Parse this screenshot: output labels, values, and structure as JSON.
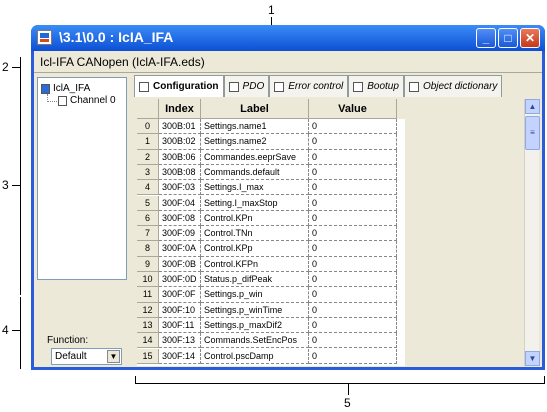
{
  "callouts": {
    "c1": "1",
    "c2": "2",
    "c3": "3",
    "c4": "4",
    "c5": "5"
  },
  "window": {
    "title": "\\3.1\\0.0 : IcIA_IFA",
    "device_header": "Icl-IFA CANopen (IclA-IFA.eds)"
  },
  "tree": {
    "root": "IclA_IFA",
    "child": "Channel 0"
  },
  "function_panel": {
    "label": "Function:",
    "selected": "Default"
  },
  "tabs": [
    "Configuration",
    "PDO",
    "Error control",
    "Bootup",
    "Object dictionary"
  ],
  "table": {
    "headers": {
      "index": "Index",
      "label": "Label",
      "value": "Value"
    },
    "rows": [
      {
        "num": "0",
        "index": "300B:01",
        "label": "Settings.name1",
        "value": "0"
      },
      {
        "num": "1",
        "index": "300B:02",
        "label": "Settings.name2",
        "value": "0"
      },
      {
        "num": "2",
        "index": "300B:06",
        "label": "Commandes.eeprSave",
        "value": "0"
      },
      {
        "num": "3",
        "index": "300B:08",
        "label": "Commands.default",
        "value": "0"
      },
      {
        "num": "4",
        "index": "300F:03",
        "label": "Settings.I_max",
        "value": "0"
      },
      {
        "num": "5",
        "index": "300F:04",
        "label": "Setting.I_maxStop",
        "value": "0"
      },
      {
        "num": "6",
        "index": "300F:08",
        "label": "Control.KPn",
        "value": "0"
      },
      {
        "num": "7",
        "index": "300F:09",
        "label": "Control.TNn",
        "value": "0"
      },
      {
        "num": "8",
        "index": "300F:0A",
        "label": "Control.KPp",
        "value": "0"
      },
      {
        "num": "9",
        "index": "300F:0B",
        "label": "Control.KFPn",
        "value": "0"
      },
      {
        "num": "10",
        "index": "300F:0D",
        "label": "Status.p_difPeak",
        "value": "0"
      },
      {
        "num": "11",
        "index": "300F:0F",
        "label": "Settings.p_win",
        "value": "0"
      },
      {
        "num": "12",
        "index": "300F:10",
        "label": "Settings.p_winTime",
        "value": "0"
      },
      {
        "num": "13",
        "index": "300F:11",
        "label": "Settings.p_maxDif2",
        "value": "0"
      },
      {
        "num": "14",
        "index": "300F:13",
        "label": "Commands.SetEncPos",
        "value": "0"
      },
      {
        "num": "15",
        "index": "300F:14",
        "label": "Control.pscDamp",
        "value": "0"
      }
    ]
  },
  "icons": {
    "app": "app-icon",
    "minimize": "minimize-icon",
    "maximize": "maximize-icon",
    "close": "close-icon",
    "scroll_up": "arrow-up-icon",
    "scroll_down": "arrow-down-icon",
    "dropdown": "chevron-down-icon"
  },
  "colors": {
    "titlebar": "#0d4fd4",
    "frame": "#2a5cd9",
    "panel": "#ece9d8",
    "tab_border": "#919b9c"
  }
}
